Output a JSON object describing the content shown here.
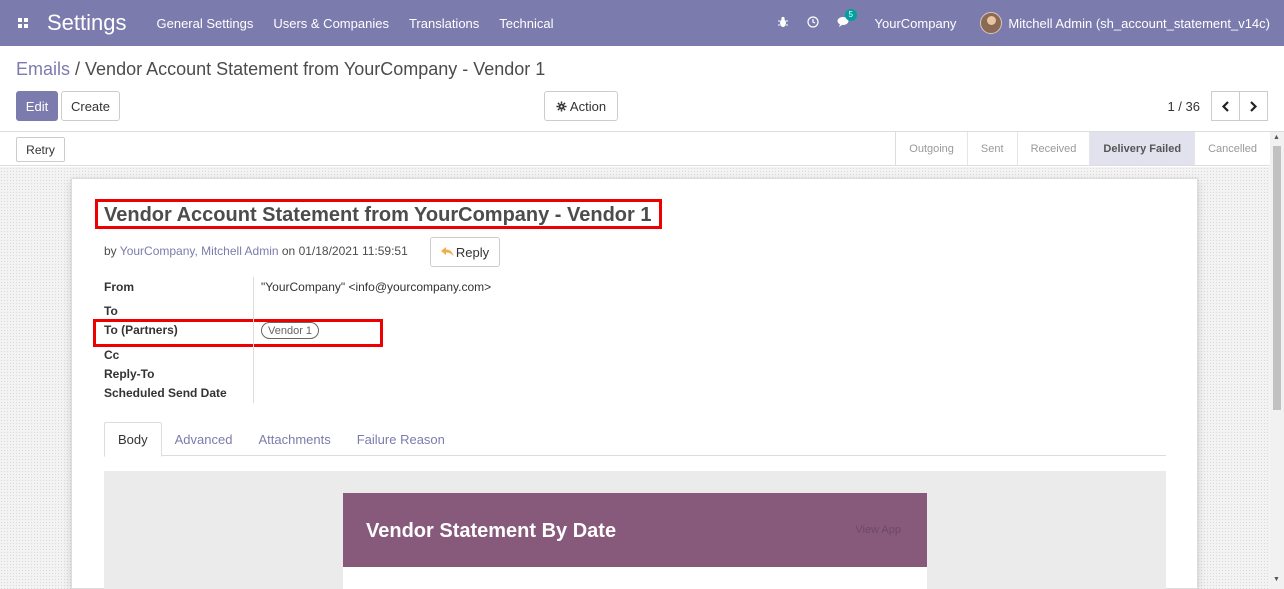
{
  "navbar": {
    "brand": "Settings",
    "menu": [
      "General Settings",
      "Users & Companies",
      "Translations",
      "Technical"
    ],
    "messages_count": "5",
    "company": "YourCompany",
    "user": "Mitchell Admin (sh_account_statement_v14c)"
  },
  "breadcrumb": {
    "parent": "Emails",
    "separator": " / ",
    "current": "Vendor Account Statement from YourCompany - Vendor 1"
  },
  "toolbar": {
    "edit_label": "Edit",
    "create_label": "Create",
    "action_label": "Action",
    "pager_value": "1 / 36"
  },
  "statusbar": {
    "retry_label": "Retry",
    "stages": [
      "Outgoing",
      "Sent",
      "Received",
      "Delivery Failed",
      "Cancelled"
    ],
    "active_stage": "Delivery Failed"
  },
  "mail": {
    "subject": "Vendor Account Statement from YourCompany - Vendor 1",
    "by_prefix": "by ",
    "author": "YourCompany, Mitchell Admin",
    "date_text": " on 01/18/2021 11:59:51",
    "reply_label": "Reply",
    "fields": {
      "from_label": "From",
      "from_value": "\"YourCompany\" <info@yourcompany.com>",
      "to_label": "To",
      "to_partners_label": "To (Partners)",
      "to_partners_tag": "Vendor 1",
      "cc_label": "Cc",
      "reply_to_label": "Reply-To",
      "scheduled_label": "Scheduled Send Date"
    }
  },
  "tabs": [
    "Body",
    "Advanced",
    "Attachments",
    "Failure Reason"
  ],
  "active_tab": "Body",
  "body": {
    "title": "Vendor Statement By Date",
    "view_app": "View App"
  },
  "colors": {
    "navbar": "#7c7bad",
    "email_header": "#875a7b",
    "highlight": "#ee0000"
  }
}
